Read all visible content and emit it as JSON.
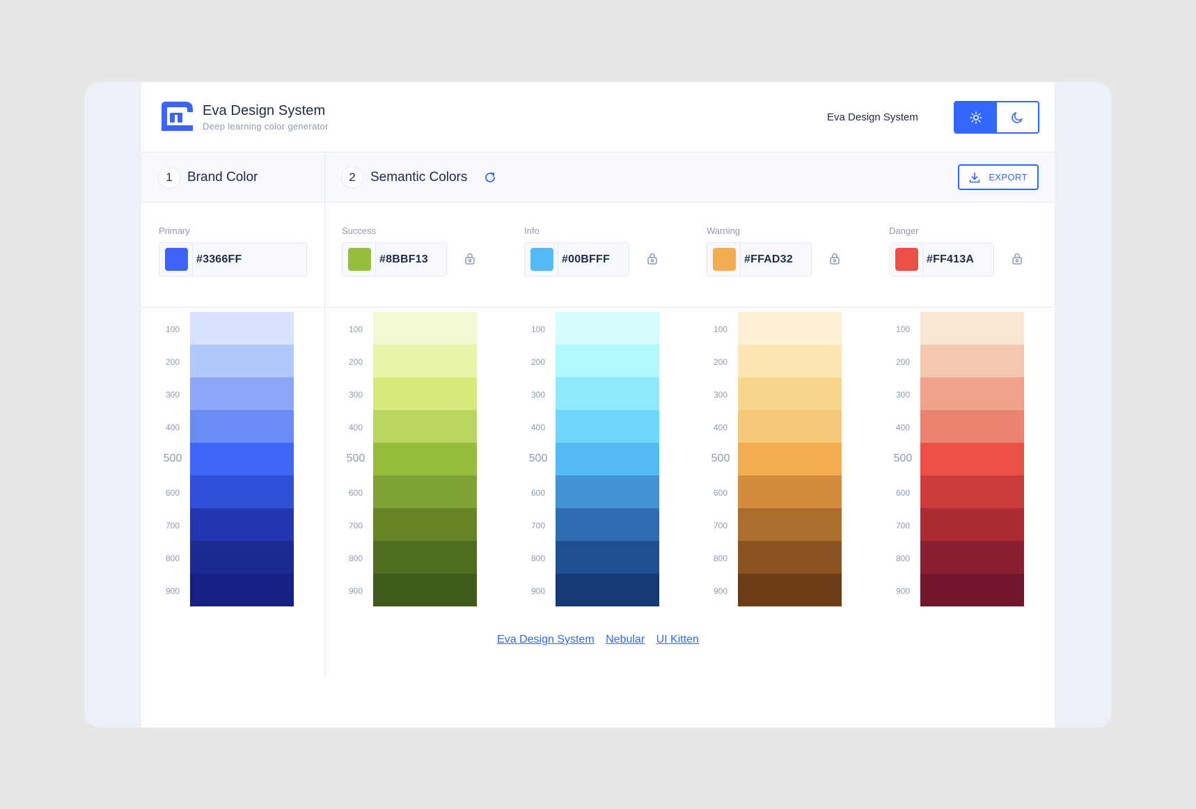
{
  "header": {
    "brand_title": "Eva Design System",
    "brand_subtitle": "Deep learning color generator",
    "link": "Eva Design System",
    "theme": {
      "light_icon": "sun-icon",
      "dark_icon": "moon-icon",
      "active": "light"
    }
  },
  "steps": {
    "brand": {
      "number": "1",
      "label": "Brand Color"
    },
    "semantic": {
      "number": "2",
      "label": "Semantic Colors",
      "refresh_icon": "refresh-icon"
    },
    "export_label": "EXPORT",
    "export_icon": "download-icon"
  },
  "colors": {
    "primary": {
      "label": "Primary",
      "hex": "#3366FF",
      "swatch": "#3d64f6"
    },
    "success": {
      "label": "Success",
      "hex": "#8BBF13",
      "swatch": "#96bd3b"
    },
    "info": {
      "label": "Info",
      "hex": "#00BFFF",
      "swatch": "#52bbf5"
    },
    "warning": {
      "label": "Warning",
      "hex": "#FFAD32",
      "swatch": "#f2ae4e"
    },
    "danger": {
      "label": "Danger",
      "hex": "#FF413A",
      "swatch": "#ea5046"
    }
  },
  "shade_labels": [
    "100",
    "200",
    "300",
    "400",
    "500",
    "600",
    "700",
    "800",
    "900"
  ],
  "palettes": {
    "primary": [
      "#d8e2fe",
      "#b2c7fb",
      "#8ba8f8",
      "#6b8bf7",
      "#3f67f5",
      "#314fd8",
      "#2236b0",
      "#1b2a8e",
      "#162082"
    ],
    "success": [
      "#f3f8d2",
      "#e8f4a8",
      "#d5e97c",
      "#b9d75e",
      "#96bd3b",
      "#7ea233",
      "#678527",
      "#4f6c21",
      "#3f5918"
    ],
    "info": [
      "#d3fcfc",
      "#b0f8fc",
      "#8ee9fa",
      "#6fd7f9",
      "#52bbf5",
      "#4193d6",
      "#306db3",
      "#1f4f8e",
      "#163a74"
    ],
    "warning": [
      "#fcf1d6",
      "#fde6b1",
      "#f8d68b",
      "#f5c877",
      "#f2ae4e",
      "#d28c3c",
      "#ac6e2e",
      "#8a5221",
      "#6e3c17"
    ],
    "danger": [
      "#fae6d2",
      "#f5c7ae",
      "#f0a38a",
      "#ec8370",
      "#ea5046",
      "#c93c3b",
      "#a92c34",
      "#8a1f31",
      "#71162d"
    ]
  },
  "footer_links": [
    "Eva Design System",
    "Nebular",
    "UI Kitten"
  ]
}
